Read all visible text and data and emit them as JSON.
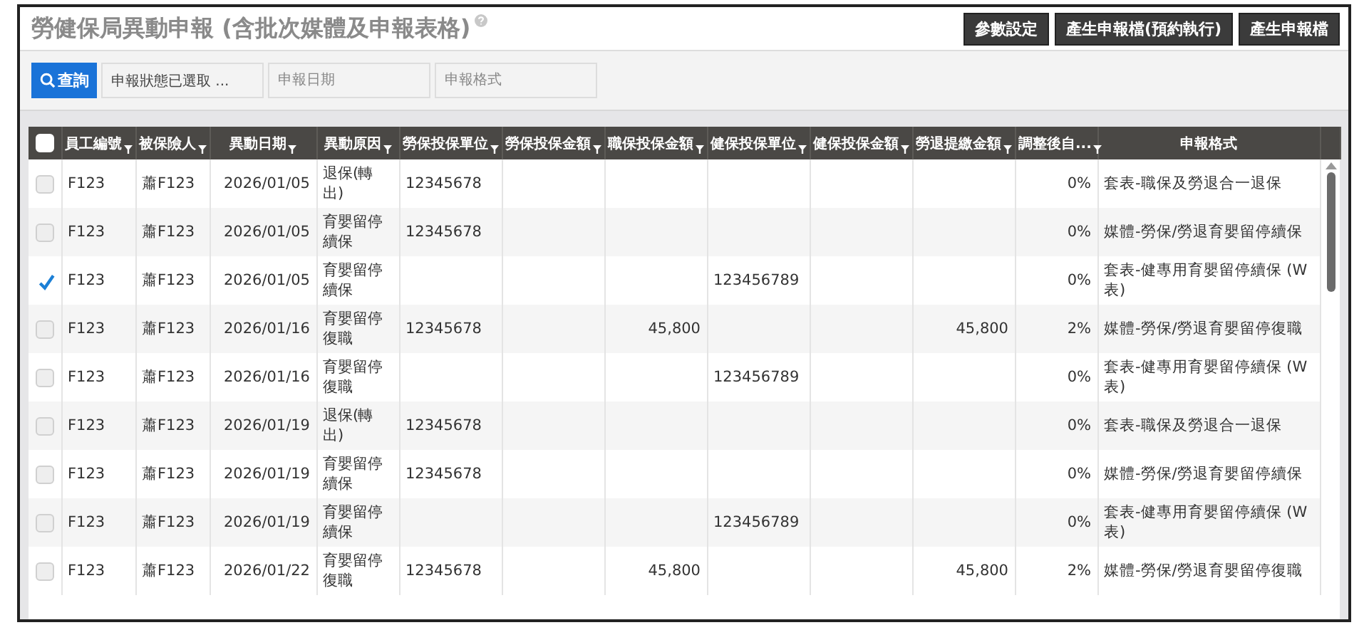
{
  "header": {
    "title": "勞健保局異動申報 (含批次媒體及申報表格)",
    "buttons": [
      "參數設定",
      "產生申報檔(預約執行)",
      "產生申報檔"
    ]
  },
  "filters": {
    "search_button": "查詢",
    "fields": [
      {
        "value": "申報狀態已選取 ..."
      },
      {
        "placeholder": "申報日期"
      },
      {
        "placeholder": "申報格式"
      }
    ]
  },
  "table": {
    "all_checked": false,
    "columns": [
      {
        "label": "員工編號",
        "kind": "text",
        "filter": true
      },
      {
        "label": "被保險人",
        "kind": "text",
        "filter": true
      },
      {
        "label": "異動日期",
        "kind": "date",
        "filter": true
      },
      {
        "label": "異動原因",
        "kind": "text",
        "filter": true
      },
      {
        "label": "勞保投保單位",
        "kind": "text",
        "filter": true
      },
      {
        "label": "勞保投保金額",
        "kind": "number",
        "filter": true
      },
      {
        "label": "職保投保金額",
        "kind": "number",
        "filter": true
      },
      {
        "label": "健保投保單位",
        "kind": "text",
        "filter": true
      },
      {
        "label": "健保投保金額",
        "kind": "number",
        "filter": true
      },
      {
        "label": "勞退提繳金額",
        "kind": "number",
        "filter": true
      },
      {
        "label": "調整後自...",
        "kind": "number",
        "filter": true
      },
      {
        "label": "申報格式",
        "kind": "text",
        "filter": false
      }
    ],
    "rows": [
      {
        "checked": false,
        "cells": [
          "F123",
          "蕭F123",
          "2026/01/05",
          "退保(轉出)",
          "12345678",
          null,
          null,
          null,
          null,
          null,
          "0%",
          "套表-職保及勞退合一退保"
        ]
      },
      {
        "checked": false,
        "cells": [
          "F123",
          "蕭F123",
          "2026/01/05",
          "育嬰留停續保",
          "12345678",
          null,
          null,
          null,
          null,
          null,
          "0%",
          "媒體-勞保/勞退育嬰留停續保"
        ]
      },
      {
        "checked": true,
        "cells": [
          "F123",
          "蕭F123",
          "2026/01/05",
          "育嬰留停續保",
          null,
          null,
          null,
          "123456789",
          null,
          null,
          "0%",
          "套表-健專用育嬰留停續保 (W表)"
        ]
      },
      {
        "checked": false,
        "cells": [
          "F123",
          "蕭F123",
          "2026/01/16",
          "育嬰留停復職",
          "12345678",
          null,
          "45,800",
          null,
          null,
          "45,800",
          "2%",
          "媒體-勞保/勞退育嬰留停復職"
        ]
      },
      {
        "checked": false,
        "cells": [
          "F123",
          "蕭F123",
          "2026/01/16",
          "育嬰留停復職",
          null,
          null,
          null,
          "123456789",
          null,
          null,
          "0%",
          "套表-健專用育嬰留停續保 (W表)"
        ]
      },
      {
        "checked": false,
        "cells": [
          "F123",
          "蕭F123",
          "2026/01/19",
          "退保(轉出)",
          "12345678",
          null,
          null,
          null,
          null,
          null,
          "0%",
          "套表-職保及勞退合一退保"
        ]
      },
      {
        "checked": false,
        "cells": [
          "F123",
          "蕭F123",
          "2026/01/19",
          "育嬰留停續保",
          "12345678",
          null,
          null,
          null,
          null,
          null,
          "0%",
          "媒體-勞保/勞退育嬰留停續保"
        ]
      },
      {
        "checked": false,
        "cells": [
          "F123",
          "蕭F123",
          "2026/01/19",
          "育嬰留停續保",
          null,
          null,
          null,
          "123456789",
          null,
          null,
          "0%",
          "套表-健專用育嬰留停續保 (W表)"
        ]
      },
      {
        "checked": false,
        "cells": [
          "F123",
          "蕭F123",
          "2026/01/22",
          "育嬰留停復職",
          "12345678",
          null,
          "45,800",
          null,
          null,
          "45,800",
          "2%",
          "媒體-勞保/勞退育嬰留停復職"
        ]
      }
    ]
  }
}
